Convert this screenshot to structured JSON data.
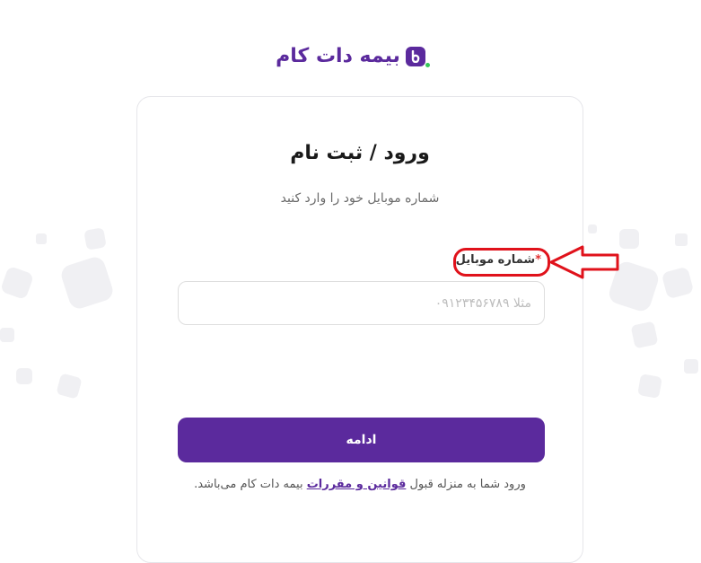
{
  "brand": {
    "name": "بیمه دات کام",
    "primary_color": "#5b2a9d",
    "accent_color": "#35c759"
  },
  "login": {
    "title": "ورود / ثبت نام",
    "subtitle": "شماره موبایل خود را وارد کنید",
    "mobile_label": "شماره موبایل",
    "required_mark": "*",
    "mobile_placeholder": "مثلا ۰۹۱۲۳۴۵۶۷۸۹",
    "mobile_value": "",
    "continue_label": "ادامه"
  },
  "terms": {
    "prefix": "ورود شما به منزله قبول ",
    "link_text": "قوانین و مقررات",
    "suffix": " بیمه دات کام می‌باشد."
  },
  "annotation": {
    "color": "#e0121b"
  }
}
